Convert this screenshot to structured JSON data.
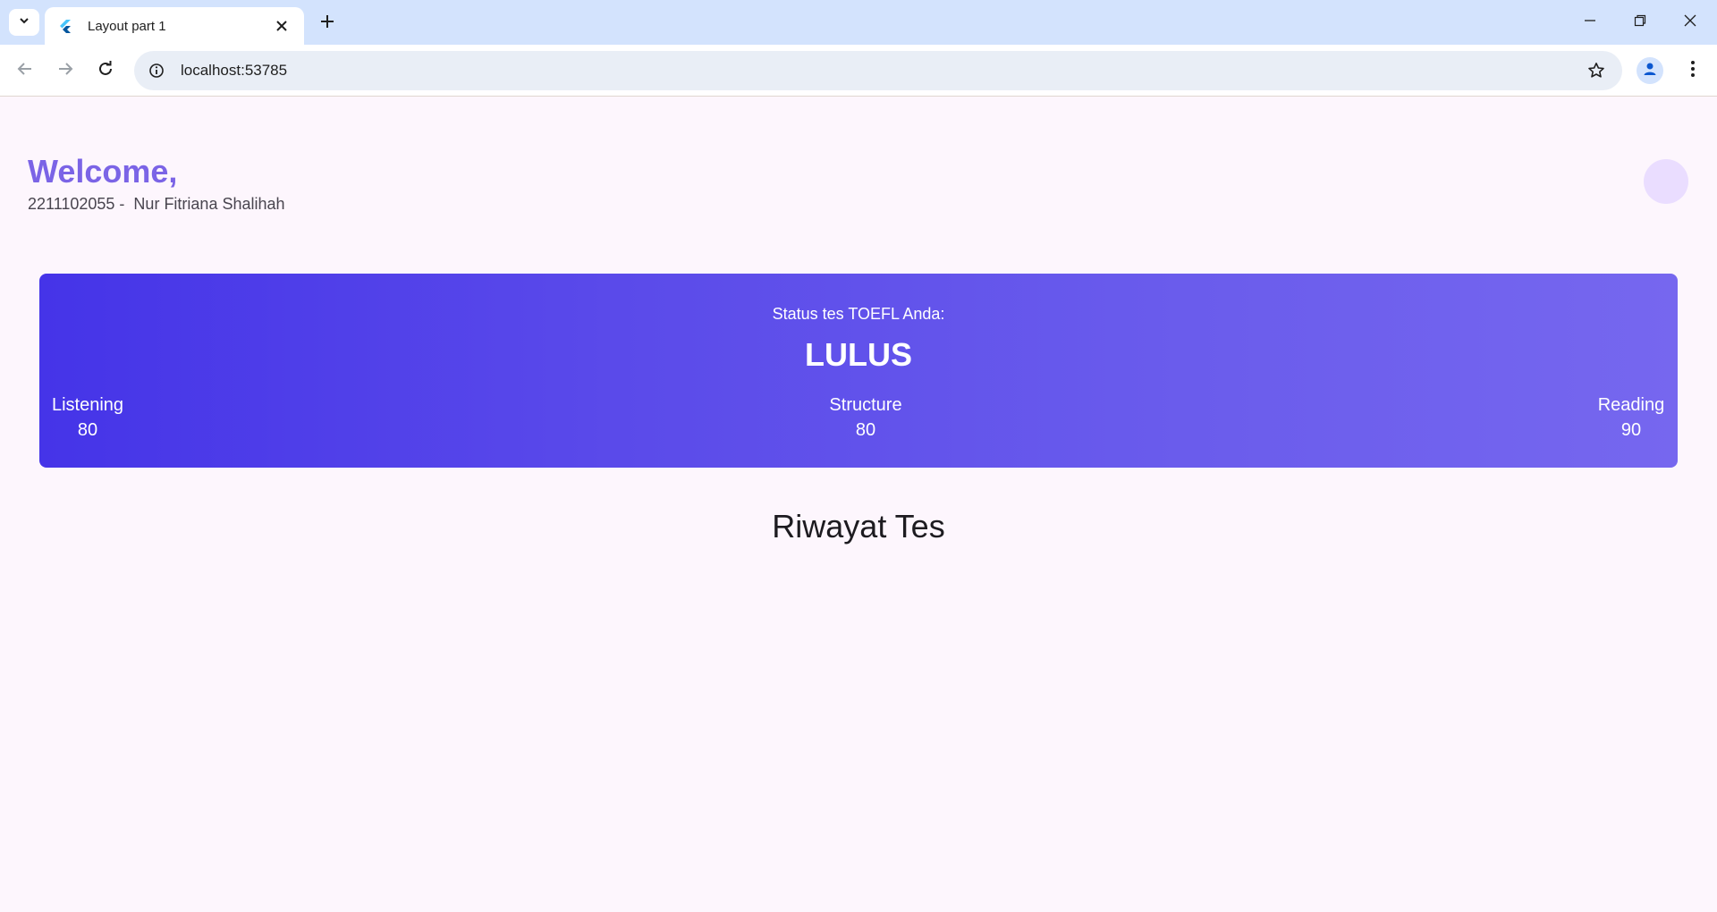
{
  "browser": {
    "tab_title": "Layout part 1",
    "url": "localhost:53785"
  },
  "header": {
    "welcome": "Welcome,",
    "subtitle": "2211102055 -  Nur Fitriana Shalihah"
  },
  "status_card": {
    "label": "Status tes TOEFL Anda:",
    "value": "LULUS",
    "scores": [
      {
        "name": "Listening",
        "value": "80"
      },
      {
        "name": "Structure",
        "value": "80"
      },
      {
        "name": "Reading",
        "value": "90"
      }
    ]
  },
  "history": {
    "title": "Riwayat Tes"
  },
  "colors": {
    "accent": "#7b64e6",
    "card_gradient_start": "#4534e8",
    "card_gradient_end": "#7667ef",
    "avatar": "#eaddff",
    "background": "#fdf6fd"
  },
  "icons": {
    "tab_search": "chevron-down-icon",
    "favicon": "flutter-icon",
    "tab_close": "close-icon",
    "new_tab": "plus-icon",
    "back": "arrow-left-icon",
    "forward": "arrow-right-icon",
    "reload": "reload-icon",
    "site_info": "info-icon",
    "bookmark": "star-icon",
    "profile": "person-icon",
    "menu": "kebab-menu-icon"
  }
}
